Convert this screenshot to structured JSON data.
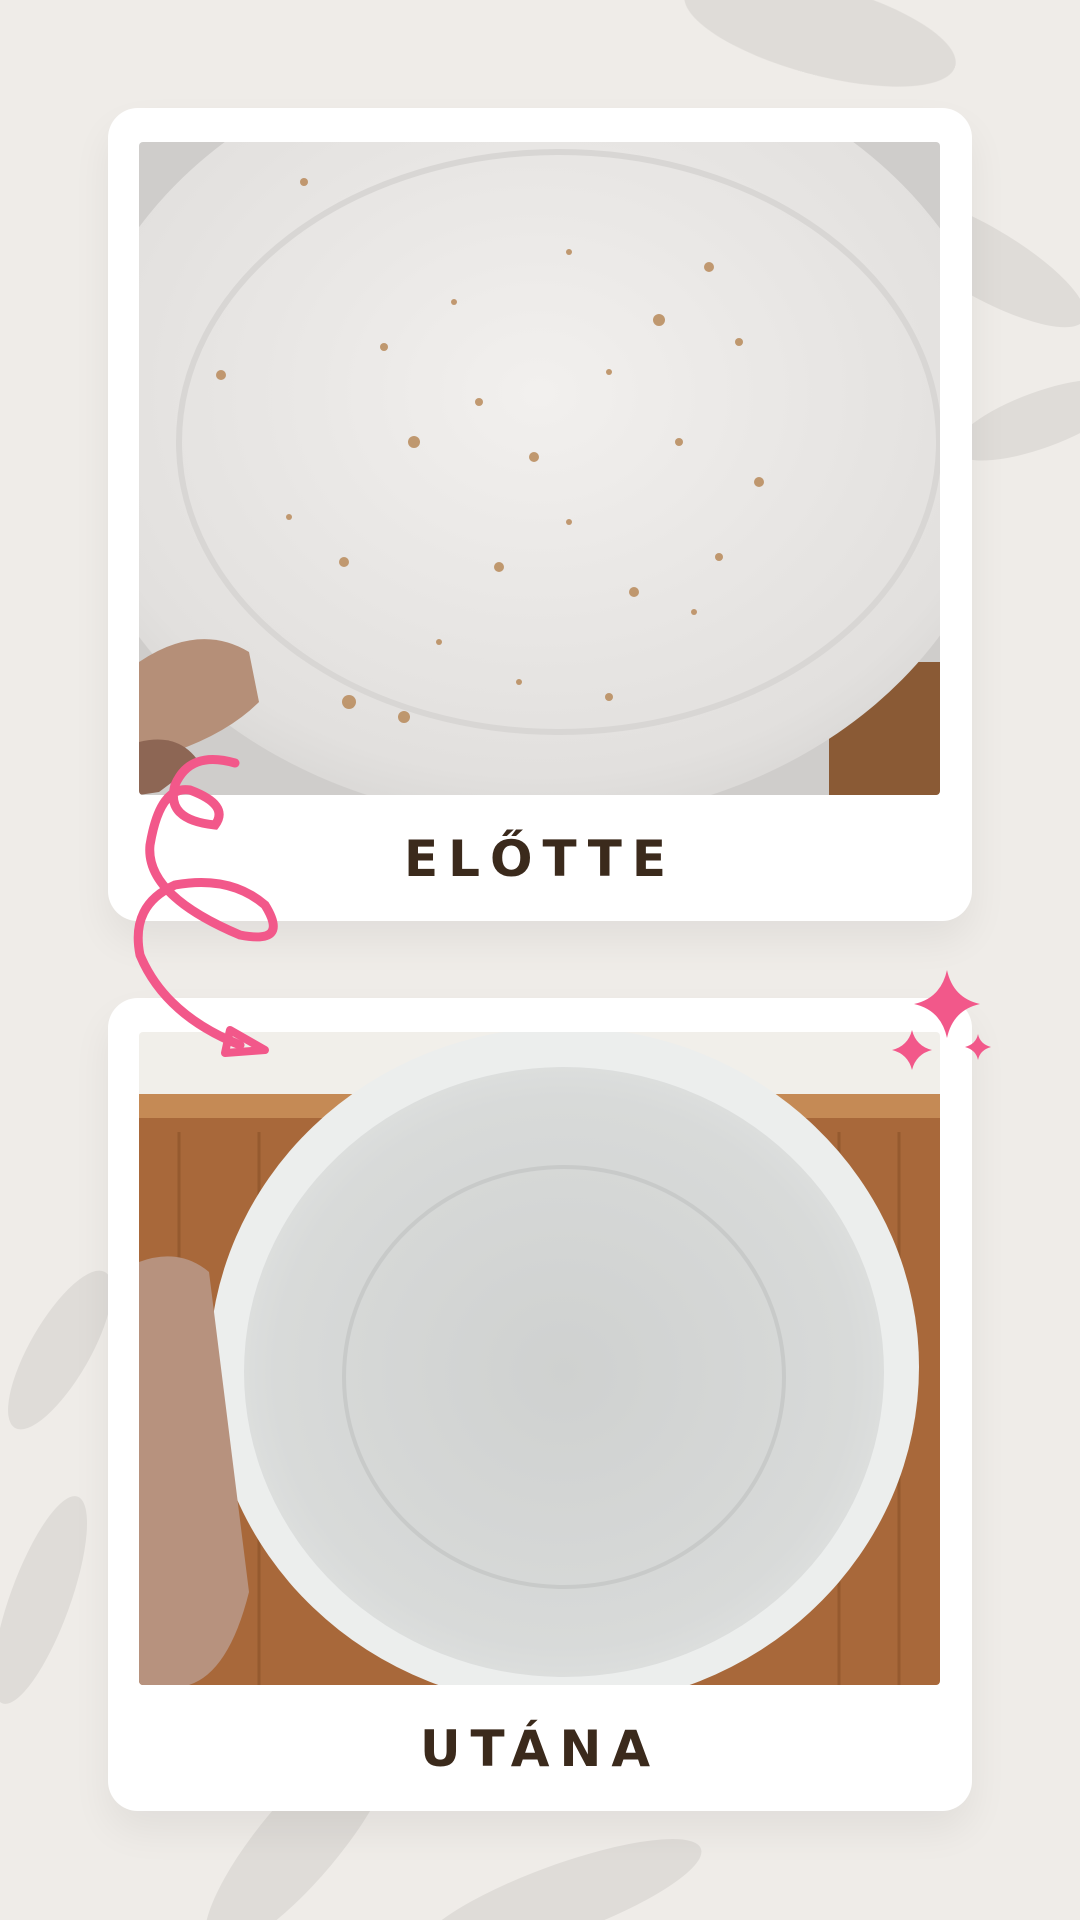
{
  "before": {
    "caption": "ELŐTTE"
  },
  "after": {
    "caption": "UTÁNA"
  },
  "colors": {
    "background": "#efece8",
    "card": "#ffffff",
    "caption_text": "#3b2a1c",
    "accent_pink": "#f2588a"
  },
  "icons": [
    "curly-arrow-icon",
    "sparkle-icon"
  ]
}
